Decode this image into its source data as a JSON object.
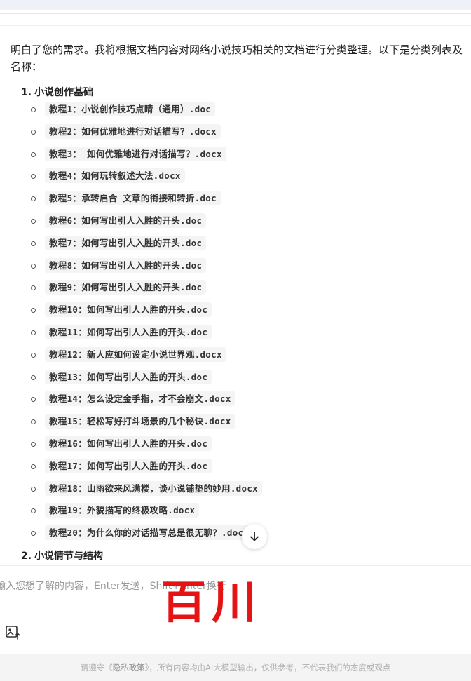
{
  "intro": {
    "line1": "明白了您的需求。我将根据文档内容对网络小说技巧相关的文档进行分类整理。以下是分类列表及",
    "line2": "名称："
  },
  "sections": [
    {
      "number": "1.",
      "title": "小说创作基础"
    },
    {
      "number": "2.",
      "title": "小说情节与结构"
    }
  ],
  "documents": [
    "教程1：小说创作技巧点睛（通用）.doc",
    "教程2：如何优雅地进行对话描写？.docx",
    "教程3： 如何优雅地进行对话描写？.docx",
    "教程4：如何玩转叙述大法.docx",
    "教程5：承转启合 文章的衔接和转折.doc",
    "教程6：如何写出引人入胜的开头.doc",
    "教程7：如何写出引人入胜的开头.doc",
    "教程8：如何写出引人入胜的开头.doc",
    "教程9：如何写出引人入胜的开头.doc",
    "教程10：如何写出引人入胜的开头.doc",
    "教程11：如何写出引人入胜的开头.doc",
    "教程12：新人应如何设定小说世界观.docx",
    "教程13：如何写出引人入胜的开头.doc",
    "教程14：怎么设定金手指，才不会崩文.docx",
    "教程15：轻松写好打斗场景的几个秘诀.docx",
    "教程16：如何写出引人入胜的开头.doc",
    "教程17：如何写出引人入胜的开头.doc",
    "教程18：山雨欲来风满楼，谈小说铺垫的妙用.docx",
    "教程19：外貌描写的终极攻略.docx",
    "教程20：为什么你的对话描写总是很无聊？.docx"
  ],
  "input": {
    "placeholder": "输入您想了解的内容，Enter发送，Shift+Enter换行"
  },
  "watermark": "百川",
  "footer": {
    "prefix": "请遵守《",
    "link": "隐私政策",
    "suffix": "》，所有内容均由AI大模型输出，仅供参考，不代表我们的态度或观点"
  },
  "icons": {
    "scroll_down": "arrow-down-icon",
    "image_upload": "image-upload-icon"
  },
  "colors": {
    "watermark": "#e41414",
    "code_background": "#f4f4f5",
    "footer_background": "#f4f4f4"
  }
}
